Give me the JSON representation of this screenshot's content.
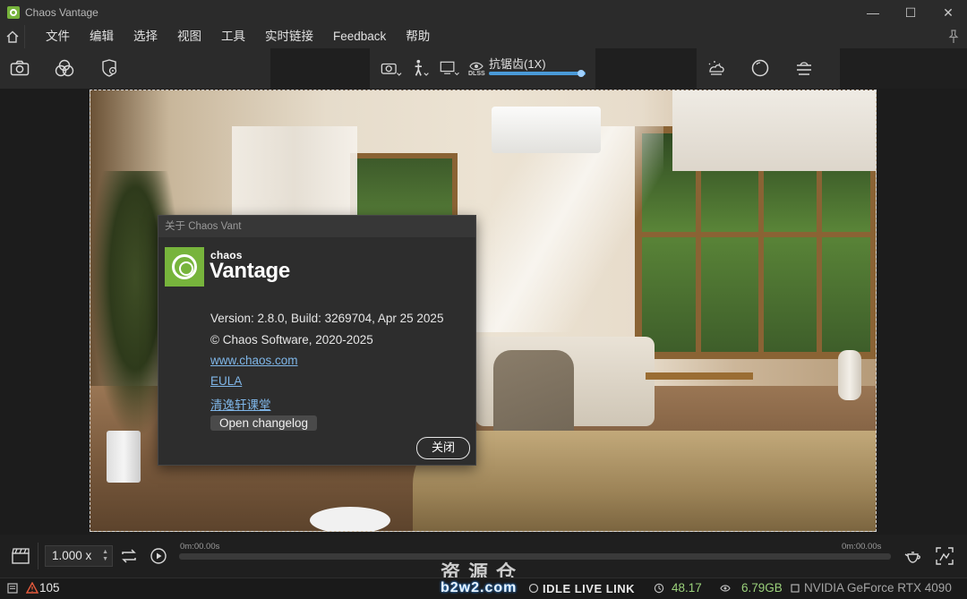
{
  "window": {
    "title": "Chaos Vantage",
    "controls": [
      "—",
      "☐",
      "✕"
    ]
  },
  "menu": {
    "items": [
      "文件",
      "编辑",
      "选择",
      "视图",
      "工具",
      "实时链接",
      "Feedback",
      "帮助"
    ]
  },
  "toolbar": {
    "antialias_label": "抗锯齿(1X)",
    "dlss_label": "DLSS",
    "antialias_level": 0.95
  },
  "about_dialog": {
    "title": "关于 Chaos Vant",
    "brand_small": "chaos",
    "brand_big": "Vantage",
    "version": "Version: 2.8.0, Build: 3269704, Apr 25 2025",
    "copyright": "© Chaos Software, 2020-2025",
    "link_website": "www.chaos.com",
    "link_eula": "EULA",
    "link_course": "清逸轩课堂",
    "changelog_button": "Open changelog",
    "close_button": "关闭"
  },
  "timeline": {
    "speed": "1.000 x",
    "time_start": "0m:00.00s",
    "time_end": "0m:00.00s"
  },
  "status": {
    "warnings": "105",
    "idle": "IDLE LIVE LINK",
    "fps": "48.17",
    "memory": "6.79GB",
    "gpu": "NVIDIA GeForce RTX 4090"
  },
  "watermark": {
    "line1": "资源仓",
    "line2": "b2w2.com"
  },
  "colors": {
    "brand_green": "#77b43c",
    "link_blue": "#7fb6e8",
    "slider_blue": "#4a9ad8",
    "status_green": "#9ad07a"
  }
}
